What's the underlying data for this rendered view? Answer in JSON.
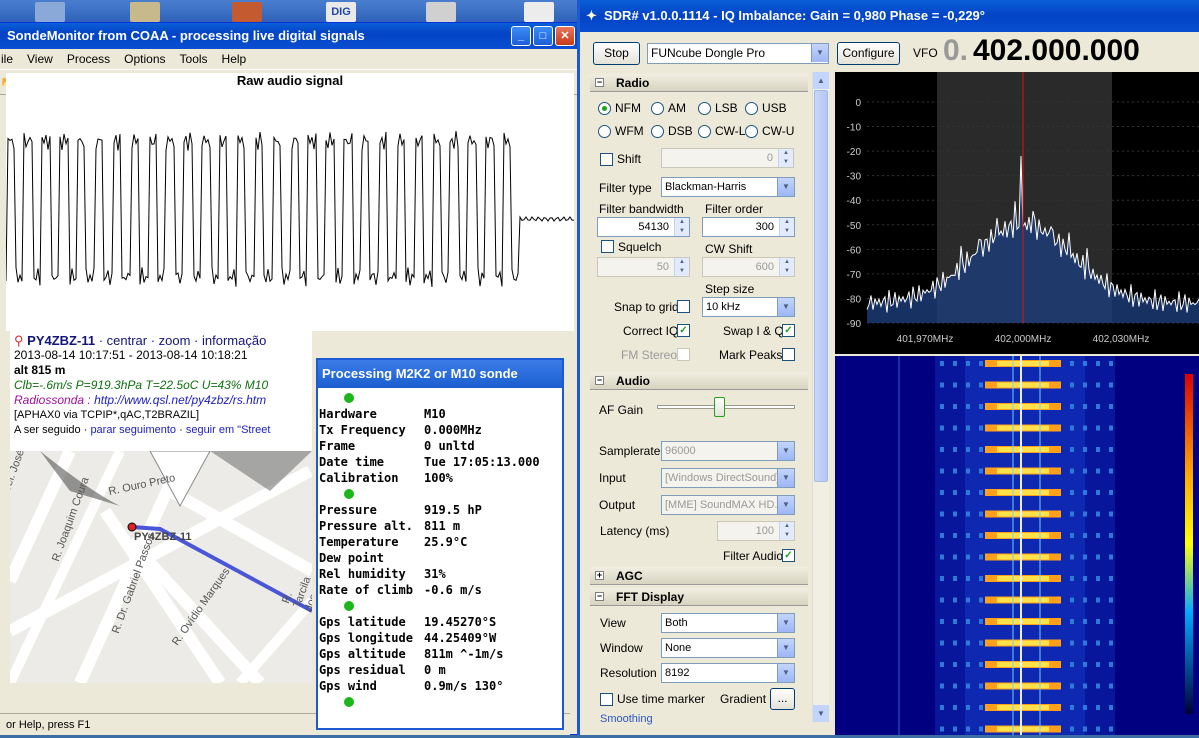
{
  "sonde": {
    "title": "SondeMonitor from COAA - processing live digital signals",
    "menu": [
      "ile",
      "View",
      "Process",
      "Options",
      "Tools",
      "Help"
    ],
    "audio_title": "Raw audio signal",
    "station": "PY4ZBZ-11",
    "station_links": "· centrar · zoom · informação",
    "time_range": "2013-08-14 10:17:51 - 2013-08-14 10:18:21",
    "alt": "alt 815 m",
    "clb": "Clb=-.6m/s P=919.3hPa T=22.5oC U=43% M10",
    "radiosonda_prefix": "Radiossonda : ",
    "radiosonda_url": "http://www.qsl.net/py4zbz/rs.htm",
    "aphax": "[APHAX0 via TCPIP*,qAC,T2BRAZIL]",
    "follow_prefix": "A ser seguido · ",
    "follow_stop": "parar seguimento",
    "follow_mid": " · ",
    "follow_street": "seguir em \"Street",
    "map_streets": [
      "R. Ouro Preto",
      "Cel. José Pereira da Ro",
      "R. Joaquim Coura",
      "R. Dr. Gabriel Passos",
      "R. Ovídio Marques",
      "R. Tarcila dos Santos"
    ],
    "status": "or Help, press F1",
    "colors": {
      "title_blue": "#0343c6",
      "route": "#4a56d8"
    }
  },
  "proc": {
    "title": "Processing M2K2 or M10 sonde",
    "group1": [
      {
        "k": "Hardware",
        "v": "M10"
      },
      {
        "k": "Tx Frequency",
        "v": "0.000MHz"
      },
      {
        "k": "Frame",
        "v": "0 unltd"
      },
      {
        "k": "Date time",
        "v": "Tue 17:05:13.000"
      },
      {
        "k": "Calibration",
        "v": "100%"
      }
    ],
    "group2": [
      {
        "k": "Pressure",
        "v": "919.5 hP"
      },
      {
        "k": "Pressure alt.",
        "v": "811 m"
      },
      {
        "k": "Temperature",
        "v": "25.9°C"
      },
      {
        "k": "Dew point",
        "v": ""
      },
      {
        "k": "Rel humidity",
        "v": "31%"
      },
      {
        "k": "Rate of climb",
        "v": "-0.6 m/s"
      }
    ],
    "group3": [
      {
        "k": "Gps latitude",
        "v": "19.45270°S"
      },
      {
        "k": "Gps longitude",
        "v": "44.25409°W"
      },
      {
        "k": "Gps altitude",
        "v": "811m ^-1m/s"
      },
      {
        "k": "Gps residual",
        "v": "0 m"
      },
      {
        "k": "Gps wind",
        "v": "0.9m/s 130°"
      }
    ]
  },
  "sdr": {
    "title": "SDR# v1.0.0.1114 - IQ Imbalance: Gain = 0,980 Phase = -0,229°",
    "stop": "Stop",
    "device": "FUNcube Dongle Pro",
    "configure": "Configure",
    "vfo_label": "VFO",
    "vfo_dim": "0.",
    "vfo_value": "402.000.000",
    "radio": {
      "header": "Radio",
      "modes": [
        "NFM",
        "AM",
        "LSB",
        "USB",
        "WFM",
        "DSB",
        "CW-L",
        "CW-U"
      ],
      "selected": "NFM",
      "shift": "Shift",
      "shift_value": "0",
      "filter_type_label": "Filter type",
      "filter_type": "Blackman-Harris",
      "filter_bw_label": "Filter bandwidth",
      "filter_bw": "54130",
      "filter_order_label": "Filter order",
      "filter_order": "300",
      "squelch": "Squelch",
      "squelch_value": "50",
      "cw_shift_label": "CW Shift",
      "cw_shift": "600",
      "step_size_label": "Step size",
      "step_size": "10 kHz",
      "snap": "Snap to grid",
      "correct_iq": "Correct IQ",
      "swap_iq": "Swap I & Q",
      "fm_stereo": "FM Stereo",
      "mark_peaks": "Mark Peaks"
    },
    "audio": {
      "header": "Audio",
      "af_gain": "AF Gain",
      "af_gain_level": 0.45,
      "samplerate_label": "Samplerate",
      "samplerate": "96000",
      "input_label": "Input",
      "input": "[Windows DirectSound]",
      "output_label": "Output",
      "output": "[MME] SoundMAX HD...",
      "latency_label": "Latency (ms)",
      "latency": "100",
      "filter_audio": "Filter Audio"
    },
    "agc": {
      "header": "AGC"
    },
    "fft": {
      "header": "FFT Display",
      "view_label": "View",
      "view": "Both",
      "window_label": "Window",
      "window": "None",
      "resolution_label": "Resolution",
      "resolution": "8192",
      "use_time_marker": "Use time marker",
      "gradient": "Gradient",
      "gradient_btn": "...",
      "smoothing": "Smoothing"
    },
    "spectrum": {
      "y_ticks": [
        "0",
        "-10",
        "-20",
        "-30",
        "-40",
        "-50",
        "-60",
        "-70",
        "-80",
        "-90"
      ],
      "x_ticks": [
        "401,970MHz",
        "402,000MHz",
        "402,030MHz"
      ]
    }
  }
}
